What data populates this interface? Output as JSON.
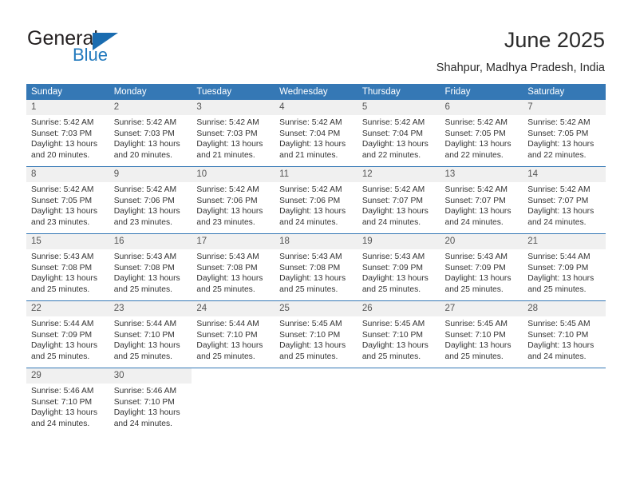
{
  "brand": {
    "name_top": "General",
    "name_bottom": "Blue",
    "color_dark": "#231f20",
    "color_blue": "#2179bd"
  },
  "header": {
    "title": "June 2025",
    "subtitle": "Shahpur, Madhya Pradesh, India"
  },
  "theme": {
    "header_blue": "#3578b5",
    "daynum_bg": "#f0f0f0"
  },
  "calendar": {
    "weekday_headers": [
      "Sunday",
      "Monday",
      "Tuesday",
      "Wednesday",
      "Thursday",
      "Friday",
      "Saturday"
    ],
    "weeks": [
      [
        {
          "day": "1",
          "sunrise": "Sunrise: 5:42 AM",
          "sunset": "Sunset: 7:03 PM",
          "daylight_1": "Daylight: 13 hours",
          "daylight_2": "and 20 minutes."
        },
        {
          "day": "2",
          "sunrise": "Sunrise: 5:42 AM",
          "sunset": "Sunset: 7:03 PM",
          "daylight_1": "Daylight: 13 hours",
          "daylight_2": "and 20 minutes."
        },
        {
          "day": "3",
          "sunrise": "Sunrise: 5:42 AM",
          "sunset": "Sunset: 7:03 PM",
          "daylight_1": "Daylight: 13 hours",
          "daylight_2": "and 21 minutes."
        },
        {
          "day": "4",
          "sunrise": "Sunrise: 5:42 AM",
          "sunset": "Sunset: 7:04 PM",
          "daylight_1": "Daylight: 13 hours",
          "daylight_2": "and 21 minutes."
        },
        {
          "day": "5",
          "sunrise": "Sunrise: 5:42 AM",
          "sunset": "Sunset: 7:04 PM",
          "daylight_1": "Daylight: 13 hours",
          "daylight_2": "and 22 minutes."
        },
        {
          "day": "6",
          "sunrise": "Sunrise: 5:42 AM",
          "sunset": "Sunset: 7:05 PM",
          "daylight_1": "Daylight: 13 hours",
          "daylight_2": "and 22 minutes."
        },
        {
          "day": "7",
          "sunrise": "Sunrise: 5:42 AM",
          "sunset": "Sunset: 7:05 PM",
          "daylight_1": "Daylight: 13 hours",
          "daylight_2": "and 22 minutes."
        }
      ],
      [
        {
          "day": "8",
          "sunrise": "Sunrise: 5:42 AM",
          "sunset": "Sunset: 7:05 PM",
          "daylight_1": "Daylight: 13 hours",
          "daylight_2": "and 23 minutes."
        },
        {
          "day": "9",
          "sunrise": "Sunrise: 5:42 AM",
          "sunset": "Sunset: 7:06 PM",
          "daylight_1": "Daylight: 13 hours",
          "daylight_2": "and 23 minutes."
        },
        {
          "day": "10",
          "sunrise": "Sunrise: 5:42 AM",
          "sunset": "Sunset: 7:06 PM",
          "daylight_1": "Daylight: 13 hours",
          "daylight_2": "and 23 minutes."
        },
        {
          "day": "11",
          "sunrise": "Sunrise: 5:42 AM",
          "sunset": "Sunset: 7:06 PM",
          "daylight_1": "Daylight: 13 hours",
          "daylight_2": "and 24 minutes."
        },
        {
          "day": "12",
          "sunrise": "Sunrise: 5:42 AM",
          "sunset": "Sunset: 7:07 PM",
          "daylight_1": "Daylight: 13 hours",
          "daylight_2": "and 24 minutes."
        },
        {
          "day": "13",
          "sunrise": "Sunrise: 5:42 AM",
          "sunset": "Sunset: 7:07 PM",
          "daylight_1": "Daylight: 13 hours",
          "daylight_2": "and 24 minutes."
        },
        {
          "day": "14",
          "sunrise": "Sunrise: 5:42 AM",
          "sunset": "Sunset: 7:07 PM",
          "daylight_1": "Daylight: 13 hours",
          "daylight_2": "and 24 minutes."
        }
      ],
      [
        {
          "day": "15",
          "sunrise": "Sunrise: 5:43 AM",
          "sunset": "Sunset: 7:08 PM",
          "daylight_1": "Daylight: 13 hours",
          "daylight_2": "and 25 minutes."
        },
        {
          "day": "16",
          "sunrise": "Sunrise: 5:43 AM",
          "sunset": "Sunset: 7:08 PM",
          "daylight_1": "Daylight: 13 hours",
          "daylight_2": "and 25 minutes."
        },
        {
          "day": "17",
          "sunrise": "Sunrise: 5:43 AM",
          "sunset": "Sunset: 7:08 PM",
          "daylight_1": "Daylight: 13 hours",
          "daylight_2": "and 25 minutes."
        },
        {
          "day": "18",
          "sunrise": "Sunrise: 5:43 AM",
          "sunset": "Sunset: 7:08 PM",
          "daylight_1": "Daylight: 13 hours",
          "daylight_2": "and 25 minutes."
        },
        {
          "day": "19",
          "sunrise": "Sunrise: 5:43 AM",
          "sunset": "Sunset: 7:09 PM",
          "daylight_1": "Daylight: 13 hours",
          "daylight_2": "and 25 minutes."
        },
        {
          "day": "20",
          "sunrise": "Sunrise: 5:43 AM",
          "sunset": "Sunset: 7:09 PM",
          "daylight_1": "Daylight: 13 hours",
          "daylight_2": "and 25 minutes."
        },
        {
          "day": "21",
          "sunrise": "Sunrise: 5:44 AM",
          "sunset": "Sunset: 7:09 PM",
          "daylight_1": "Daylight: 13 hours",
          "daylight_2": "and 25 minutes."
        }
      ],
      [
        {
          "day": "22",
          "sunrise": "Sunrise: 5:44 AM",
          "sunset": "Sunset: 7:09 PM",
          "daylight_1": "Daylight: 13 hours",
          "daylight_2": "and 25 minutes."
        },
        {
          "day": "23",
          "sunrise": "Sunrise: 5:44 AM",
          "sunset": "Sunset: 7:10 PM",
          "daylight_1": "Daylight: 13 hours",
          "daylight_2": "and 25 minutes."
        },
        {
          "day": "24",
          "sunrise": "Sunrise: 5:44 AM",
          "sunset": "Sunset: 7:10 PM",
          "daylight_1": "Daylight: 13 hours",
          "daylight_2": "and 25 minutes."
        },
        {
          "day": "25",
          "sunrise": "Sunrise: 5:45 AM",
          "sunset": "Sunset: 7:10 PM",
          "daylight_1": "Daylight: 13 hours",
          "daylight_2": "and 25 minutes."
        },
        {
          "day": "26",
          "sunrise": "Sunrise: 5:45 AM",
          "sunset": "Sunset: 7:10 PM",
          "daylight_1": "Daylight: 13 hours",
          "daylight_2": "and 25 minutes."
        },
        {
          "day": "27",
          "sunrise": "Sunrise: 5:45 AM",
          "sunset": "Sunset: 7:10 PM",
          "daylight_1": "Daylight: 13 hours",
          "daylight_2": "and 25 minutes."
        },
        {
          "day": "28",
          "sunrise": "Sunrise: 5:45 AM",
          "sunset": "Sunset: 7:10 PM",
          "daylight_1": "Daylight: 13 hours",
          "daylight_2": "and 24 minutes."
        }
      ],
      [
        {
          "day": "29",
          "sunrise": "Sunrise: 5:46 AM",
          "sunset": "Sunset: 7:10 PM",
          "daylight_1": "Daylight: 13 hours",
          "daylight_2": "and 24 minutes."
        },
        {
          "day": "30",
          "sunrise": "Sunrise: 5:46 AM",
          "sunset": "Sunset: 7:10 PM",
          "daylight_1": "Daylight: 13 hours",
          "daylight_2": "and 24 minutes."
        },
        {
          "day": "",
          "sunrise": "",
          "sunset": "",
          "daylight_1": "",
          "daylight_2": ""
        },
        {
          "day": "",
          "sunrise": "",
          "sunset": "",
          "daylight_1": "",
          "daylight_2": ""
        },
        {
          "day": "",
          "sunrise": "",
          "sunset": "",
          "daylight_1": "",
          "daylight_2": ""
        },
        {
          "day": "",
          "sunrise": "",
          "sunset": "",
          "daylight_1": "",
          "daylight_2": ""
        },
        {
          "day": "",
          "sunrise": "",
          "sunset": "",
          "daylight_1": "",
          "daylight_2": ""
        }
      ]
    ]
  }
}
